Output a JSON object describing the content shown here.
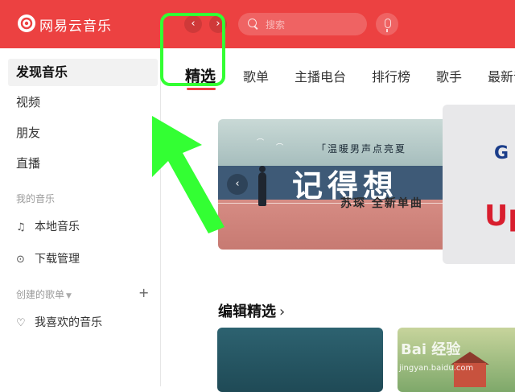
{
  "app": {
    "name": "网易云音乐",
    "accent_color": "#ec4141"
  },
  "header": {
    "back_icon": "chevron-left-icon",
    "forward_icon": "chevron-right-icon",
    "search_placeholder": "搜索",
    "mic_icon": "microphone-icon"
  },
  "sidebar": {
    "items": [
      {
        "label": "发现音乐",
        "active": true
      },
      {
        "label": "视频"
      },
      {
        "label": "朋友"
      },
      {
        "label": "直播"
      }
    ],
    "my_music_header": "我的音乐",
    "my_music": [
      {
        "label": "本地音乐",
        "icon": "music-note-icon"
      },
      {
        "label": "下载管理",
        "icon": "download-icon"
      }
    ],
    "created_playlists_header": "创建的歌单",
    "playlists": [
      {
        "label": "我喜欢的音乐",
        "icon": "heart-icon"
      }
    ]
  },
  "tabs": [
    {
      "label": "精选",
      "active": true
    },
    {
      "label": "歌单"
    },
    {
      "label": "主播电台"
    },
    {
      "label": "排行榜"
    },
    {
      "label": "歌手"
    },
    {
      "label": "最新音"
    }
  ],
  "banner": {
    "subtitle": "「温暖男声点亮夏",
    "title": "记得想",
    "artist": "苏琛  全新单曲"
  },
  "side_card": {
    "line1": "G",
    "line2": "Up"
  },
  "section": {
    "title": "编辑精选"
  },
  "watermark": {
    "text": "Bai 经验",
    "sub": "jingyan.baidu.com"
  },
  "annotation": {
    "box_color": "#33ff33",
    "arrow_color": "#33ff33"
  }
}
